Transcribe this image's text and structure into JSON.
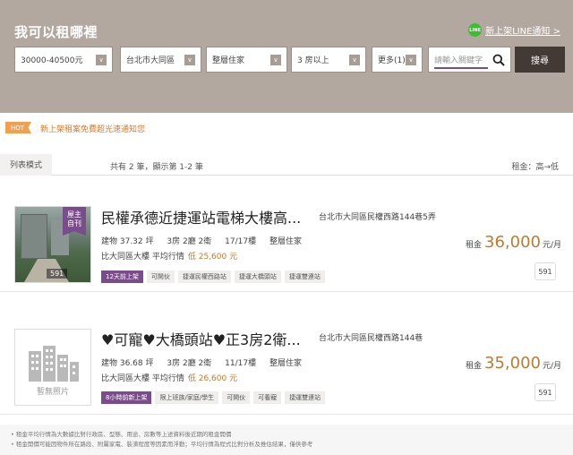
{
  "search": {
    "title": "我可以租哪裡",
    "line_label": "LINE",
    "line_notify": "新上架LINE通知 >",
    "filters": {
      "price": "30000-40500元",
      "district": "台北市大同區",
      "type": "整層住家",
      "rooms": "3 房以上",
      "more": "更多(1)"
    },
    "chevron": "∨",
    "keyword_placeholder": "請輸入關鍵字",
    "search_button": "搜尋"
  },
  "hot": {
    "badge": "HOT",
    "text": "新上架租案免費超光速通知您"
  },
  "list_bar": {
    "tab": "列表模式",
    "count": "共有 2 筆，顯示第 1-2 筆",
    "sort": "租金：高→低"
  },
  "listings": [
    {
      "owner_tag_line1": "屋主",
      "owner_tag_line2": "自刊",
      "photo_count": "591",
      "title": "民權承德近捷運站電梯大樓高...",
      "address": "台北市大同區民權西路144巷5弄",
      "area": "建物 37.32 坪",
      "layout": "3房 2廳 2衛",
      "floor": "17/17樓",
      "category": "整層住家",
      "avg_label": "比大同區大樓 平均行情",
      "avg_value": "低 25,600 元",
      "tags": [
        "12天前上架",
        "可開伙",
        "捷運民權西路站",
        "捷運大橋頭站",
        "捷運雙連站"
      ],
      "rent_label": "租金",
      "rent": "36,000",
      "rent_unit": "元/月",
      "img_count": "591"
    },
    {
      "no_photo": "暫無照片",
      "title": "♥可寵♥大橋頭站♥正3房2衛...",
      "address": "台北市大同區民權西路144巷",
      "area": "建物 36.68 坪",
      "layout": "3房 2廳 2衛",
      "floor": "11/17樓",
      "category": "整層住家",
      "avg_label": "比大同區大樓 平均行情",
      "avg_value": "低 26,600 元",
      "tags": [
        "8小時前新上架",
        "限上班族/家庭/學生",
        "可開伙",
        "可養寵",
        "捷運雙連站"
      ],
      "rent_label": "租金",
      "rent": "35,000",
      "rent_unit": "元/月",
      "img_count": "591"
    }
  ],
  "footnotes": [
    "租金平均行情為大數據比對行政區、型態、用途、房數等上述資料後近期的租金開價",
    "租金開價可能因物件所在路段、附屬家電、裝潢程度等因素而浮動；平均行情為程式比對分析及推估結果，僅供參考"
  ]
}
